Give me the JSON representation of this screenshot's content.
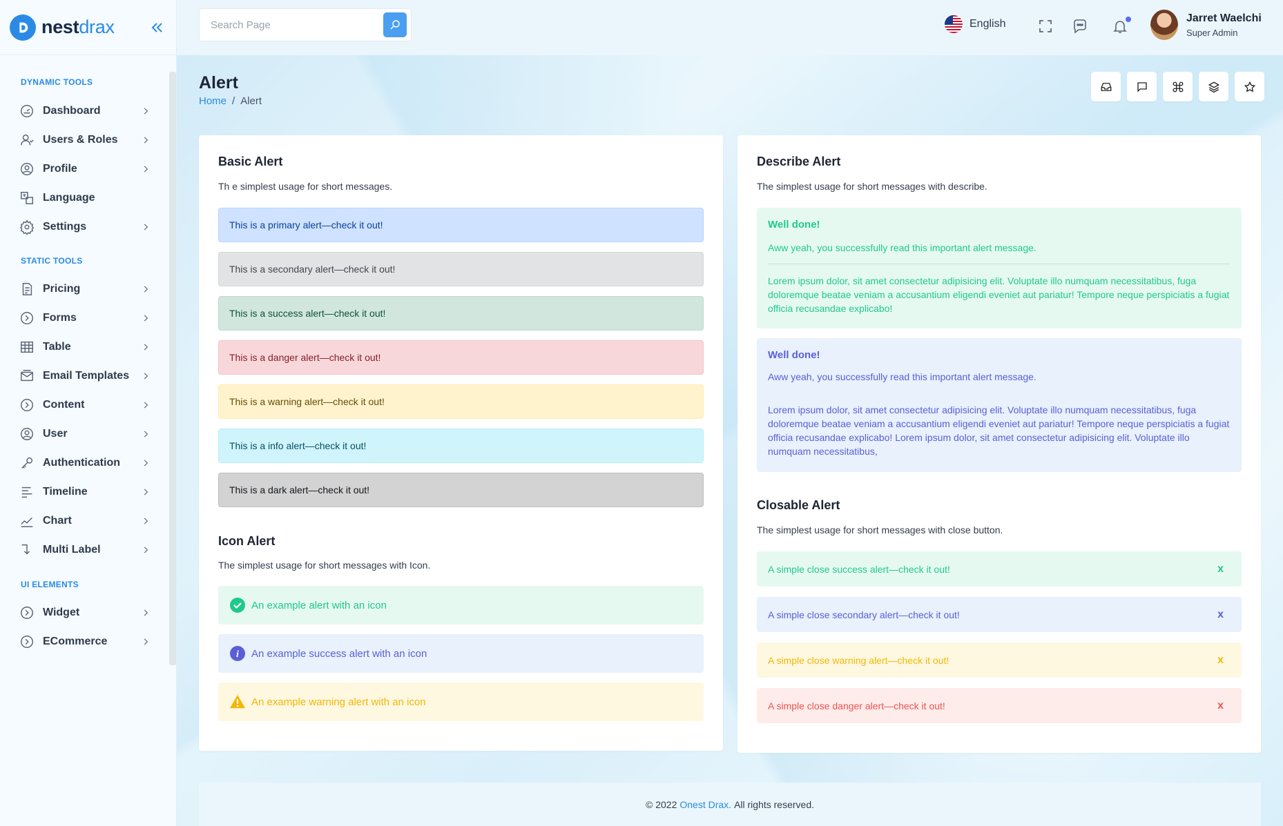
{
  "brand": {
    "name_a": "nest",
    "name_b": "drax"
  },
  "sidebar": {
    "sections": [
      {
        "title": "DYNAMIC TOOLS"
      },
      {
        "title": "STATIC TOOLS"
      },
      {
        "title": "UI ELEMENTS"
      }
    ],
    "items": [
      {
        "label": "Dashboard",
        "icon": "dashboard-icon"
      },
      {
        "label": "Users & Roles",
        "icon": "users-icon"
      },
      {
        "label": "Profile",
        "icon": "profile-icon"
      },
      {
        "label": "Language",
        "icon": "language-icon"
      },
      {
        "label": "Settings",
        "icon": "gear-icon"
      },
      {
        "label": "Pricing",
        "icon": "pricing-icon"
      },
      {
        "label": "Forms",
        "icon": "forms-icon"
      },
      {
        "label": "Table",
        "icon": "table-icon"
      },
      {
        "label": "Email Templates",
        "icon": "email-icon"
      },
      {
        "label": "Content",
        "icon": "content-icon"
      },
      {
        "label": "User",
        "icon": "user-icon"
      },
      {
        "label": "Authentication",
        "icon": "key-icon"
      },
      {
        "label": "Timeline",
        "icon": "timeline-icon"
      },
      {
        "label": "Chart",
        "icon": "chart-icon"
      },
      {
        "label": "Multi Label",
        "icon": "multi-label-icon"
      },
      {
        "label": "Widget",
        "icon": "widget-icon"
      },
      {
        "label": "ECommerce",
        "icon": "ecommerce-icon"
      }
    ]
  },
  "header": {
    "search_placeholder": "Search Page",
    "language": "English",
    "user_name": "Jarret Waelchi",
    "user_role": "Super Admin"
  },
  "page": {
    "title": "Alert",
    "breadcrumb_home": "Home",
    "breadcrumb_sep": "/",
    "breadcrumb_current": "Alert"
  },
  "basic": {
    "title": "Basic Alert",
    "subtitle": "Th e simplest usage for short messages.",
    "alerts": [
      "This is a primary alert—check it out!",
      "This is a secondary alert—check it out!",
      "This is a success alert—check it out!",
      "This is a danger alert—check it out!",
      "This is a warning alert—check it out!",
      "This is a info alert—check it out!",
      "This is a dark alert—check it out!"
    ]
  },
  "icon_alert": {
    "title": "Icon Alert",
    "subtitle": "The simplest usage for short messages with Icon.",
    "alerts": [
      "An example alert with an icon",
      "An example success alert with an icon",
      "An example warning alert with an icon"
    ]
  },
  "describe": {
    "title": "Describe Alert",
    "subtitle": "The simplest usage for short messages with describe.",
    "alerts": [
      {
        "heading": "Well done!",
        "message": "Aww yeah, you successfully read this important alert message.",
        "body": "Lorem ipsum dolor, sit amet consectetur adipisicing elit. Voluptate illo numquam necessitatibus, fuga doloremque beatae veniam a accusantium eligendi eveniet aut pariatur! Tempore neque perspiciatis a fugiat officia recusandae explicabo!"
      },
      {
        "heading": "Well done!",
        "message": "Aww yeah, you successfully read this important alert message.",
        "body": "Lorem ipsum dolor, sit amet consectetur adipisicing elit. Voluptate illo numquam necessitatibus, fuga doloremque beatae veniam a accusantium eligendi eveniet aut pariatur! Tempore neque perspiciatis a fugiat officia recusandae explicabo! Lorem ipsum dolor, sit amet consectetur adipisicing elit. Voluptate illo numquam necessitatibus,"
      }
    ]
  },
  "closable": {
    "title": "Closable Alert",
    "subtitle": "The simplest usage for short messages with close button.",
    "close_label": "x",
    "alerts": [
      "A simple close success alert—check it out!",
      "A simple close secondary alert—check it out!",
      "A simple close warning alert—check it out!",
      "A simple close danger alert—check it out!"
    ]
  },
  "footer": {
    "prefix": "© 2022",
    "brand": "Onest Drax.",
    "suffix": "All rights reserved."
  },
  "colors": {
    "accent": "#2a8ae6",
    "success_text": "#1fc98e",
    "info_text": "#5a5fd6",
    "warning_text": "#f2b705",
    "danger_text": "#ef5350"
  }
}
